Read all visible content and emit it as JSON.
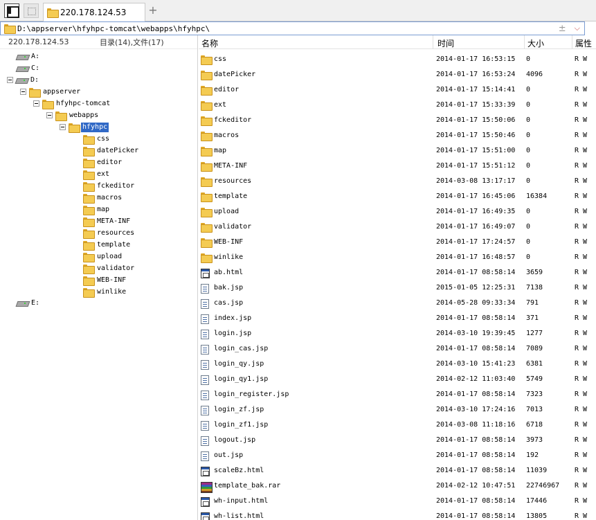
{
  "tabs": [
    {
      "label": "220.178.124.53"
    }
  ],
  "address": {
    "path": "D:\\appserver\\hfyhpc-tomcat\\webapps\\hfyhpc\\",
    "plusminus": "±"
  },
  "left_header": {
    "host": "220.178.124.53",
    "count": "目录(14),文件(17)"
  },
  "tree": [
    {
      "label": "A:",
      "type": "drive",
      "level": 0,
      "expander": false
    },
    {
      "label": "C:",
      "type": "drive",
      "level": 0,
      "expander": false
    },
    {
      "label": "D:",
      "type": "drive",
      "level": 0,
      "expander": true
    },
    {
      "label": "appserver",
      "type": "folder",
      "level": 1,
      "expander": true
    },
    {
      "label": "hfyhpc-tomcat",
      "type": "folder",
      "level": 2,
      "expander": true
    },
    {
      "label": "webapps",
      "type": "folder",
      "level": 3,
      "expander": true
    },
    {
      "label": "hfyhpc",
      "type": "folder",
      "level": 4,
      "expander": true,
      "selected": true
    },
    {
      "label": "css",
      "type": "folder",
      "level": 5,
      "expander": false
    },
    {
      "label": "datePicker",
      "type": "folder",
      "level": 5,
      "expander": false
    },
    {
      "label": "editor",
      "type": "folder",
      "level": 5,
      "expander": false
    },
    {
      "label": "ext",
      "type": "folder",
      "level": 5,
      "expander": false
    },
    {
      "label": "fckeditor",
      "type": "folder",
      "level": 5,
      "expander": false
    },
    {
      "label": "macros",
      "type": "folder",
      "level": 5,
      "expander": false
    },
    {
      "label": "map",
      "type": "folder",
      "level": 5,
      "expander": false
    },
    {
      "label": "META-INF",
      "type": "folder",
      "level": 5,
      "expander": false
    },
    {
      "label": "resources",
      "type": "folder",
      "level": 5,
      "expander": false
    },
    {
      "label": "template",
      "type": "folder",
      "level": 5,
      "expander": false
    },
    {
      "label": "upload",
      "type": "folder",
      "level": 5,
      "expander": false
    },
    {
      "label": "validator",
      "type": "folder",
      "level": 5,
      "expander": false
    },
    {
      "label": "WEB-INF",
      "type": "folder",
      "level": 5,
      "expander": false
    },
    {
      "label": "winlike",
      "type": "folder",
      "level": 5,
      "expander": false
    },
    {
      "label": "E:",
      "type": "drive",
      "level": 0,
      "expander": false,
      "gap_before": true
    }
  ],
  "columns": {
    "name": "名称",
    "time": "时间",
    "size": "大小",
    "attr": "属性"
  },
  "files": [
    {
      "name": "css",
      "time": "2014-01-17 16:53:15",
      "size": "0",
      "attr": "R W",
      "icon": "folder"
    },
    {
      "name": "datePicker",
      "time": "2014-01-17 16:53:24",
      "size": "4096",
      "attr": "R W",
      "icon": "folder"
    },
    {
      "name": "editor",
      "time": "2014-01-17 15:14:41",
      "size": "0",
      "attr": "R W",
      "icon": "folder"
    },
    {
      "name": "ext",
      "time": "2014-01-17 15:33:39",
      "size": "0",
      "attr": "R W",
      "icon": "folder"
    },
    {
      "name": "fckeditor",
      "time": "2014-01-17 15:50:06",
      "size": "0",
      "attr": "R W",
      "icon": "folder"
    },
    {
      "name": "macros",
      "time": "2014-01-17 15:50:46",
      "size": "0",
      "attr": "R W",
      "icon": "folder"
    },
    {
      "name": "map",
      "time": "2014-01-17 15:51:00",
      "size": "0",
      "attr": "R W",
      "icon": "folder"
    },
    {
      "name": "META-INF",
      "time": "2014-01-17 15:51:12",
      "size": "0",
      "attr": "R W",
      "icon": "folder"
    },
    {
      "name": "resources",
      "time": "2014-03-08 13:17:17",
      "size": "0",
      "attr": "R W",
      "icon": "folder"
    },
    {
      "name": "template",
      "time": "2014-01-17 16:45:06",
      "size": "16384",
      "attr": "R W",
      "icon": "folder"
    },
    {
      "name": "upload",
      "time": "2014-01-17 16:49:35",
      "size": "0",
      "attr": "R W",
      "icon": "folder"
    },
    {
      "name": "validator",
      "time": "2014-01-17 16:49:07",
      "size": "0",
      "attr": "R W",
      "icon": "folder"
    },
    {
      "name": "WEB-INF",
      "time": "2014-01-17 17:24:57",
      "size": "0",
      "attr": "R W",
      "icon": "folder"
    },
    {
      "name": "winlike",
      "time": "2014-01-17 16:48:57",
      "size": "0",
      "attr": "R W",
      "icon": "folder"
    },
    {
      "name": "ab.html",
      "time": "2014-01-17 08:58:14",
      "size": "3659",
      "attr": "R W",
      "icon": "html"
    },
    {
      "name": "bak.jsp",
      "time": "2015-01-05 12:25:31",
      "size": "7138",
      "attr": "R W",
      "icon": "doc"
    },
    {
      "name": "cas.jsp",
      "time": "2014-05-28 09:33:34",
      "size": "791",
      "attr": "R W",
      "icon": "doc"
    },
    {
      "name": "index.jsp",
      "time": "2014-01-17 08:58:14",
      "size": "371",
      "attr": "R W",
      "icon": "doc"
    },
    {
      "name": "login.jsp",
      "time": "2014-03-10 19:39:45",
      "size": "1277",
      "attr": "R W",
      "icon": "doc"
    },
    {
      "name": "login_cas.jsp",
      "time": "2014-01-17 08:58:14",
      "size": "7089",
      "attr": "R W",
      "icon": "doc"
    },
    {
      "name": "login_qy.jsp",
      "time": "2014-03-10 15:41:23",
      "size": "6381",
      "attr": "R W",
      "icon": "doc"
    },
    {
      "name": "login_qy1.jsp",
      "time": "2014-02-12 11:03:40",
      "size": "5749",
      "attr": "R W",
      "icon": "doc"
    },
    {
      "name": "login_register.jsp",
      "time": "2014-01-17 08:58:14",
      "size": "7323",
      "attr": "R W",
      "icon": "doc"
    },
    {
      "name": "login_zf.jsp",
      "time": "2014-03-10 17:24:16",
      "size": "7013",
      "attr": "R W",
      "icon": "doc"
    },
    {
      "name": "login_zf1.jsp",
      "time": "2014-03-08 11:18:16",
      "size": "6718",
      "attr": "R W",
      "icon": "doc"
    },
    {
      "name": "logout.jsp",
      "time": "2014-01-17 08:58:14",
      "size": "3973",
      "attr": "R W",
      "icon": "doc"
    },
    {
      "name": "out.jsp",
      "time": "2014-01-17 08:58:14",
      "size": "192",
      "attr": "R W",
      "icon": "doc"
    },
    {
      "name": "scaleBz.html",
      "time": "2014-01-17 08:58:14",
      "size": "11039",
      "attr": "R W",
      "icon": "html"
    },
    {
      "name": "template_bak.rar",
      "time": "2014-02-12 10:47:51",
      "size": "22746967",
      "attr": "R W",
      "icon": "rar"
    },
    {
      "name": "wh-input.html",
      "time": "2014-01-17 08:58:14",
      "size": "17446",
      "attr": "R W",
      "icon": "html"
    },
    {
      "name": "wh-list.html",
      "time": "2014-01-17 08:58:14",
      "size": "13805",
      "attr": "R W",
      "icon": "html"
    }
  ]
}
